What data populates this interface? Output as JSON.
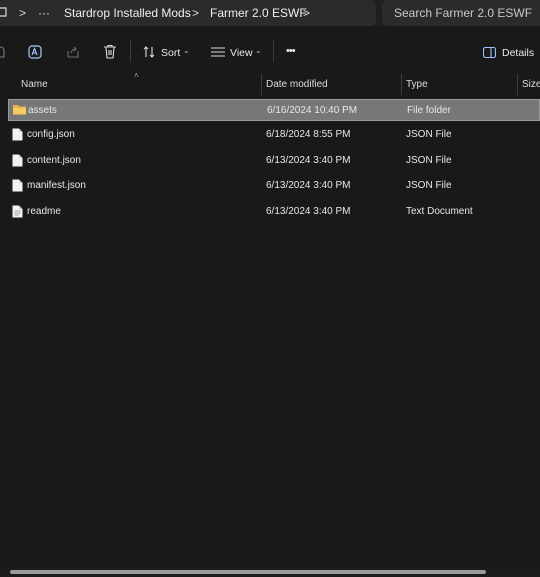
{
  "breadcrumb": {
    "items": [
      "Stardrop Installed Mods",
      "Farmer 2.0 ESWF"
    ],
    "separator": ">",
    "overflow": "···"
  },
  "search": {
    "placeholder": "Search Farmer 2.0 ESWF"
  },
  "toolbar": {
    "sort_label": "Sort",
    "view_label": "View",
    "more_label": "•••",
    "details_label": "Details",
    "icons": [
      "new-item-icon",
      "rename-icon",
      "share-icon",
      "delete-icon",
      "sort-icon",
      "view-icon",
      "more-icon",
      "details-pane-icon"
    ]
  },
  "columns": {
    "name": "Name",
    "date": "Date modified",
    "type": "Type",
    "size": "Size"
  },
  "files": [
    {
      "name": "assets",
      "date": "6/16/2024 10:40 PM",
      "type": "File folder",
      "icon": "folder-icon",
      "selected": true
    },
    {
      "name": "config.json",
      "date": "6/18/2024 8:55 PM",
      "type": "JSON File",
      "icon": "file-icon",
      "selected": false
    },
    {
      "name": "content.json",
      "date": "6/13/2024 3:40 PM",
      "type": "JSON File",
      "icon": "file-icon",
      "selected": false
    },
    {
      "name": "manifest.json",
      "date": "6/13/2024 3:40 PM",
      "type": "JSON File",
      "icon": "file-icon",
      "selected": false
    },
    {
      "name": "readme",
      "date": "6/13/2024 3:40 PM",
      "type": "Text Document",
      "icon": "text-file-icon",
      "selected": false
    }
  ],
  "colors": {
    "background": "#191919",
    "selection": "#777777",
    "folder": "#e8b84a"
  }
}
